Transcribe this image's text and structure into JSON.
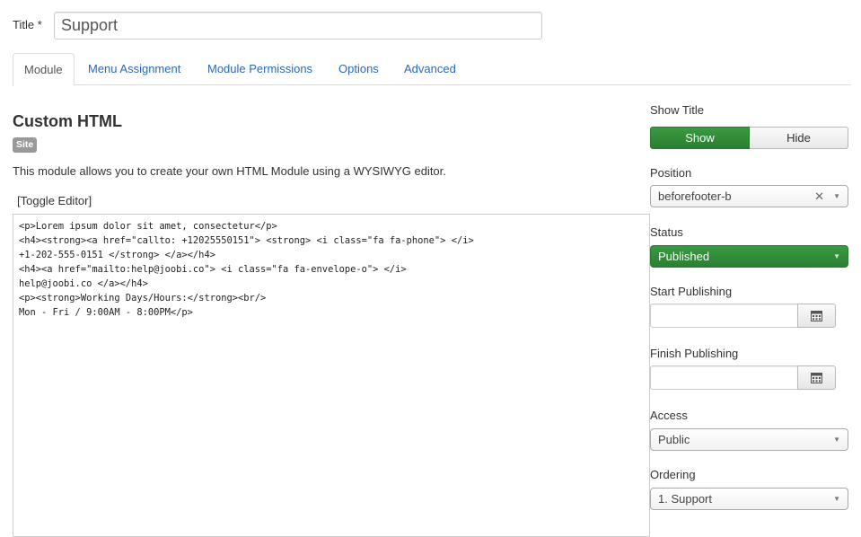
{
  "title_field": {
    "label": "Title *",
    "value": "Support"
  },
  "tabs": [
    {
      "label": "Module",
      "active": true
    },
    {
      "label": "Menu Assignment"
    },
    {
      "label": "Module Permissions"
    },
    {
      "label": "Options"
    },
    {
      "label": "Advanced"
    }
  ],
  "module": {
    "heading": "Custom HTML",
    "badge": "Site",
    "description": "This module allows you to create your own HTML Module using a WYSIWYG editor.",
    "toggle_editor": "[Toggle Editor]",
    "editor_lines": [
      "<p>Lorem ipsum dolor sit amet, consectetur</p>",
      "<h4><strong><a href=\"callto: +12025550151\"> <strong> <i class=\"fa fa-phone\"> </i>",
      "+1-202-555-0151 </strong> </a></h4>",
      "<h4><a href=\"mailto:help@joobi.co\"> <i class=\"fa fa-envelope-o\"> </i>",
      "help@joobi.co </a></h4>",
      "<p><strong>Working Days/Hours:</strong><br/>",
      "Mon - Fri / 9:00AM - 8:00PM</p>"
    ]
  },
  "sidebar": {
    "show_title": {
      "label": "Show Title",
      "show": "Show",
      "hide": "Hide",
      "selected": "Show"
    },
    "position": {
      "label": "Position",
      "value": "beforefooter-b"
    },
    "status": {
      "label": "Status",
      "value": "Published"
    },
    "start_publishing": {
      "label": "Start Publishing",
      "value": ""
    },
    "finish_publishing": {
      "label": "Finish Publishing",
      "value": ""
    },
    "access": {
      "label": "Access",
      "value": "Public"
    },
    "ordering": {
      "label": "Ordering",
      "value": "1. Support"
    }
  },
  "colors": {
    "link": "#2a69b8",
    "success": "#2f8a36",
    "badge": "#999999"
  }
}
